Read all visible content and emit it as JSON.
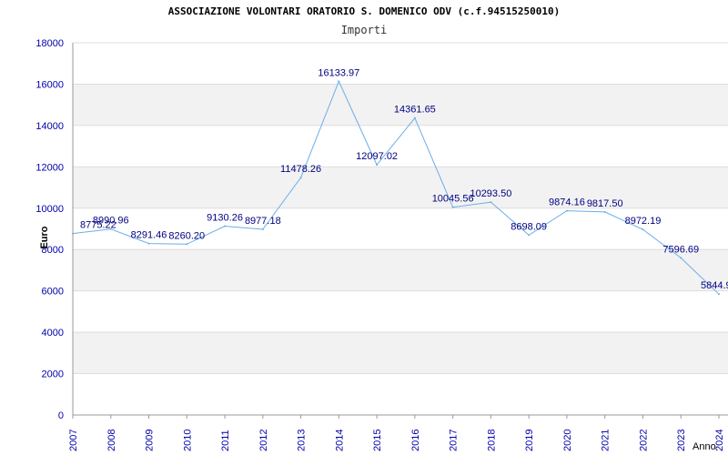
{
  "chart_data": {
    "type": "line",
    "title": "ASSOCIAZIONE VOLONTARI ORATORIO S. DOMENICO ODV (c.f.94515250010)",
    "subtitle": "Importi",
    "xlabel": "Anno",
    "ylabel": "Euro",
    "ylim": [
      0,
      18000
    ],
    "yticks": [
      0,
      2000,
      4000,
      6000,
      8000,
      10000,
      12000,
      14000,
      16000,
      18000
    ],
    "grid": "horizontal alternating bands",
    "categories": [
      "2007",
      "2008",
      "2009",
      "2010",
      "2011",
      "2012",
      "2013",
      "2014",
      "2015",
      "2016",
      "2017",
      "2018",
      "2019",
      "2020",
      "2021",
      "2022",
      "2023",
      "2024"
    ],
    "values": [
      8775.22,
      8990.96,
      8291.46,
      8260.2,
      9130.26,
      8977.18,
      11478.26,
      16133.97,
      12097.02,
      14361.65,
      10045.56,
      10293.5,
      8698.09,
      9874.16,
      9817.5,
      8972.19,
      7596.69,
      5844.9
    ],
    "value_labels": [
      "8775.22",
      "8990.96",
      "8291.46",
      "8260.20",
      "9130.26",
      "8977.18",
      "11478.26",
      "16133.97",
      "12097.02",
      "14361.65",
      "10045.56",
      "10293.50",
      "8698.09",
      "9874.16",
      "9817.50",
      "8972.19",
      "7596.69",
      "5844.9"
    ],
    "colors": {
      "line": "#6aaee8",
      "axis_tick_label": "#0000aa",
      "data_label": "#000080",
      "band": "#f2f2f2",
      "grid": "#dddddd"
    }
  }
}
